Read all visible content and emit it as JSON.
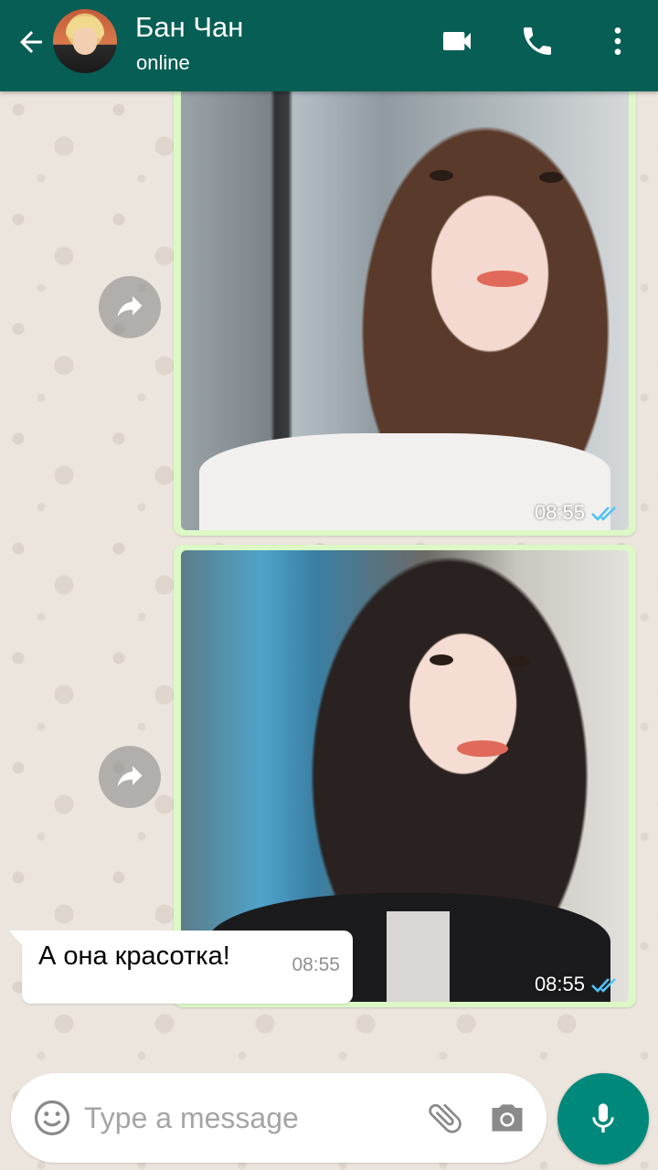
{
  "header": {
    "contact_name": "Бан Чан",
    "status": "online"
  },
  "messages": [
    {
      "type": "image",
      "direction": "outgoing",
      "time": "08:55",
      "status": "read"
    },
    {
      "type": "image",
      "direction": "outgoing",
      "time": "08:55",
      "status": "read"
    },
    {
      "type": "text",
      "direction": "incoming",
      "text": "А она красотка!",
      "time": "08:55"
    }
  ],
  "composer": {
    "placeholder": "Type a message"
  },
  "icons": {
    "back": "arrow-left-icon",
    "video_call": "video-camera-icon",
    "voice_call": "phone-icon",
    "menu": "more-vertical-icon",
    "forward": "forward-arrow-icon",
    "read_receipt": "double-check-icon",
    "emoji": "smiley-icon",
    "attach": "paperclip-icon",
    "camera": "camera-icon",
    "mic": "microphone-icon"
  },
  "colors": {
    "header_bg": "#075e54",
    "chat_bg": "#ece5dd",
    "outgoing_bubble": "#dcf8c6",
    "incoming_bubble": "#ffffff",
    "read_receipt": "#4fc3f7",
    "mic_button": "#00897b"
  }
}
